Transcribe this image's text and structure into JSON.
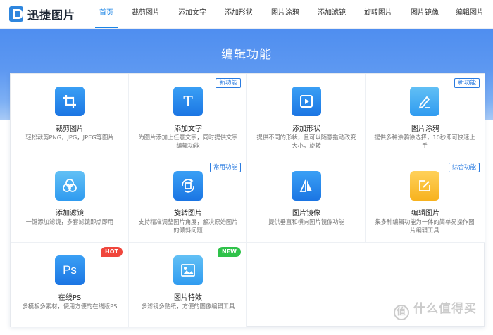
{
  "brand": {
    "name": "迅捷图片"
  },
  "nav": [
    {
      "label": "首页",
      "active": true
    },
    {
      "label": "裁剪图片"
    },
    {
      "label": "添加文字"
    },
    {
      "label": "添加形状"
    },
    {
      "label": "图片涂鸦"
    },
    {
      "label": "添加滤镜"
    },
    {
      "label": "旋转图片"
    },
    {
      "label": "图片镜像"
    },
    {
      "label": "编辑图片"
    }
  ],
  "hero": {
    "title": "编辑功能"
  },
  "features": [
    {
      "title": "裁剪图片",
      "desc": "轻松裁剪PNG，JPG，JPEG等图片",
      "icon": "crop-icon",
      "color": "blue"
    },
    {
      "title": "添加文字",
      "desc": "为图片添加上任意文字，同时提供文字编辑功能",
      "icon": "text-icon",
      "color": "blue",
      "badge": "新功能"
    },
    {
      "title": "添加形状",
      "desc": "提供不同的形状，且可以随意拖动改变大小，旋转",
      "icon": "shape-icon",
      "color": "blue"
    },
    {
      "title": "图片涂鸦",
      "desc": "提供多种涂鸦徐选择，10秒即可快速上手",
      "icon": "pen-icon",
      "color": "lightblue",
      "badge": "新功能"
    },
    {
      "title": "添加滤镜",
      "desc": "一键添加滤镜，多套滤镜即点即用",
      "icon": "filter-icon",
      "color": "lightblue"
    },
    {
      "title": "旋转图片",
      "desc": "支持精准调整图片角度，解决原始图片的倾斜问题",
      "icon": "rotate-icon",
      "color": "blue",
      "badge": "常用功能"
    },
    {
      "title": "图片镜像",
      "desc": "提供垂直和横向图片镜像功能",
      "icon": "mirror-icon",
      "color": "blue"
    },
    {
      "title": "编辑图片",
      "desc": "集多种编辑功能为一体的简单易操作图片编辑工具",
      "icon": "edit-icon",
      "color": "yellow",
      "badge": "综合功能"
    },
    {
      "title": "在线PS",
      "desc": "多模板多素材，使用方便的在线版PS",
      "icon": "ps-icon",
      "color": "blue",
      "pill": "HOT",
      "pill_color": "#f0463c"
    },
    {
      "title": "图片特效",
      "desc": "多滤镜多贴纸，方便的图像编辑工具",
      "icon": "image-effect-icon",
      "color": "lightblue",
      "pill": "NEW",
      "pill_color": "#2fc24a"
    }
  ],
  "watermark": {
    "text": "什么值得买",
    "mark": "值"
  }
}
